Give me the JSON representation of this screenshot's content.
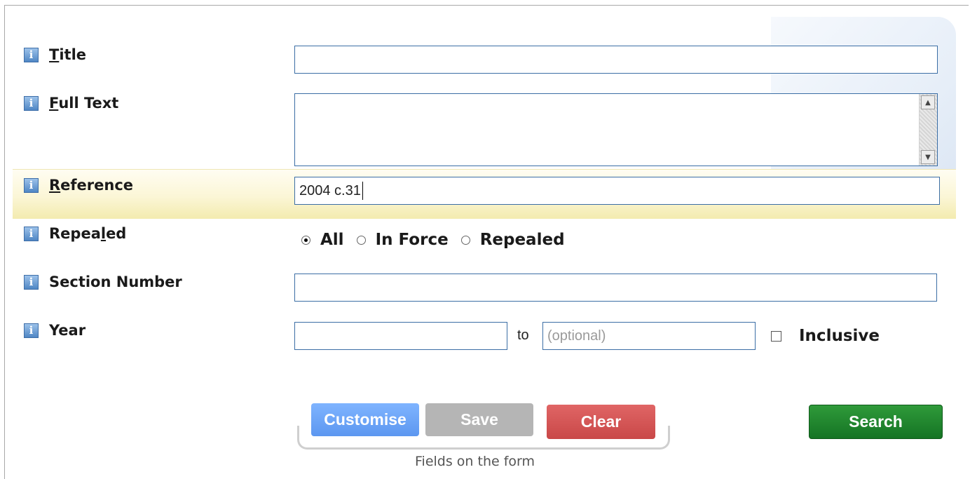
{
  "fields": {
    "title": {
      "pre": "",
      "ul": "T",
      "post": "itle",
      "value": ""
    },
    "full_text": {
      "pre": "",
      "ul": "F",
      "post": "ull Text",
      "value": ""
    },
    "reference": {
      "pre": "",
      "ul": "R",
      "post": "eference",
      "value": "2004 c.31"
    },
    "repealed": {
      "pre": "Repea",
      "ul": "l",
      "post": "ed",
      "options": [
        {
          "label": "All",
          "checked": true
        },
        {
          "label": "In Force",
          "checked": false
        },
        {
          "label": "Repealed",
          "checked": false
        }
      ]
    },
    "section_number": {
      "label": "Section Number",
      "value": ""
    },
    "year": {
      "label": "Year",
      "from_value": "",
      "to_text": "to",
      "to_placeholder": "(optional)",
      "inclusive_label": "Inclusive",
      "inclusive_checked": false
    }
  },
  "info_icon_glyph": "i",
  "buttons": {
    "customise": "Customise",
    "save": "Save",
    "clear": "Clear",
    "search": "Search"
  },
  "fields_caption": "Fields on the form",
  "colors": {
    "customise": "#6aa6fa",
    "save": "#b5b5b5",
    "clear": "#d45656",
    "search": "#1e8a2e",
    "input_border": "#3b6ea5",
    "highlight": "#f8f1c4"
  },
  "icons": {
    "info": "info-icon",
    "scroll_up": "scroll-up-arrow-icon",
    "scroll_down": "scroll-down-arrow-icon"
  }
}
